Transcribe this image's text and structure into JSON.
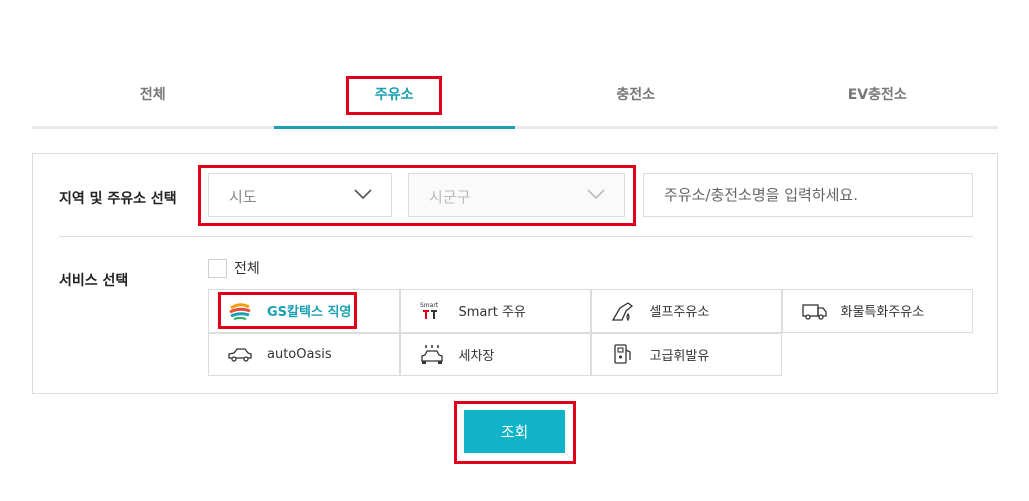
{
  "tabs": [
    {
      "label": "전체",
      "active": false
    },
    {
      "label": "주유소",
      "active": true
    },
    {
      "label": "충전소",
      "active": false
    },
    {
      "label": "EV충전소",
      "active": false
    }
  ],
  "region": {
    "label": "지역 및 주유소 선택",
    "sido": "시도",
    "sigungu": "시군구",
    "search_placeholder": "주유소/충전소명을 입력하세요."
  },
  "service": {
    "label": "서비스 선택",
    "all_label": "전체",
    "items": [
      {
        "label": "GS칼텍스 직영",
        "icon": "gs-caltex-logo-icon"
      },
      {
        "label": "Smart 주유",
        "icon": "smart-fuel-icon",
        "icon_text": "Smart"
      },
      {
        "label": "셀프주유소",
        "icon": "self-fuel-nozzle-icon"
      },
      {
        "label": "화물특화주유소",
        "icon": "truck-icon"
      },
      {
        "label": "autoOasis",
        "icon": "car-icon"
      },
      {
        "label": "세차장",
        "icon": "car-wash-icon"
      },
      {
        "label": "고급휘발유",
        "icon": "premium-gasoline-pump-icon"
      }
    ]
  },
  "search_button": "조회",
  "colors": {
    "accent": "#1aa0b3",
    "button": "#10b3c8",
    "highlight": "#e1001a"
  }
}
